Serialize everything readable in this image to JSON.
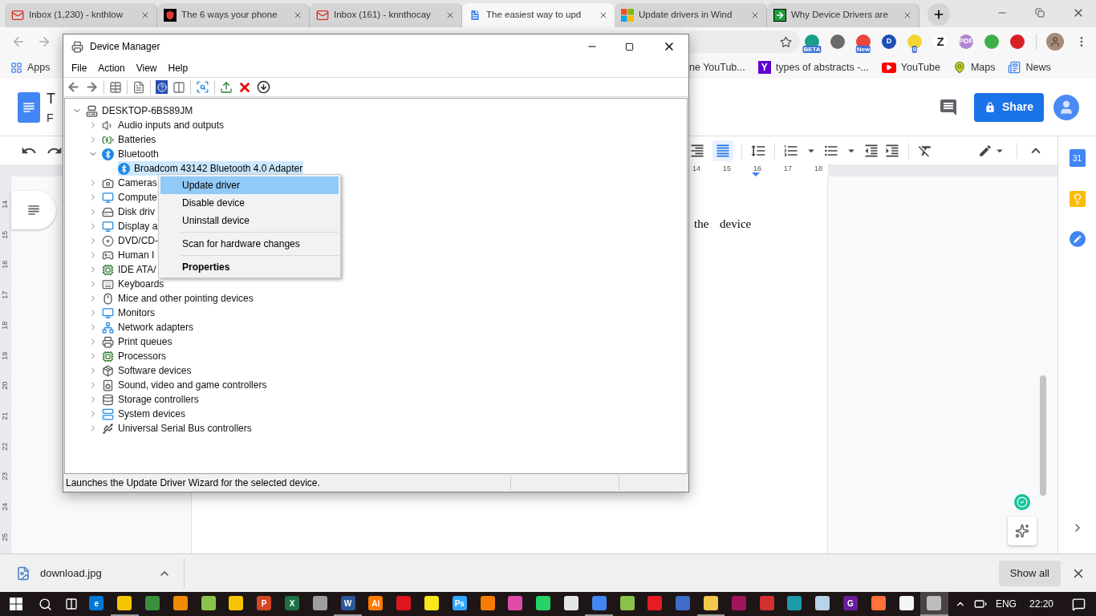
{
  "browser": {
    "tabs": [
      {
        "title": "Inbox (1,230) - knthlow",
        "kind": "gmail",
        "selected": false
      },
      {
        "title": "The 6 ways your phone",
        "kind": "shield",
        "selected": false
      },
      {
        "title": "Inbox (161) - knnthocay",
        "kind": "gmail",
        "selected": false
      },
      {
        "title": "The easiest way to upd",
        "kind": "docs",
        "selected": true
      },
      {
        "title": "Update drivers in Wind",
        "kind": "windows",
        "selected": false
      },
      {
        "title": "Why Device Drivers are",
        "kind": "arrow",
        "selected": false
      }
    ],
    "extensions": [
      {
        "color": "#1a9e8c",
        "badge": "BETA"
      },
      {
        "color": "#6b6b6b"
      },
      {
        "color": "#e8453c",
        "badge": "New"
      },
      {
        "color": "#1e4fb5",
        "glyph": "D"
      },
      {
        "color": "#f5d533",
        "badge": "0"
      },
      {
        "color": "#ffffff",
        "glyph": "Z"
      },
      {
        "color": "#b184d1",
        "glyph": "PDF"
      },
      {
        "color": "#3fae49"
      },
      {
        "color": "#d91f26"
      }
    ],
    "bookmarks": [
      {
        "label": "Apps",
        "kind": "grid"
      },
      {
        "label": "ne YouTub...",
        "kind": "plain"
      },
      {
        "label": "types of abstracts -...",
        "kind": "yahoo",
        "glyph": "Y"
      },
      {
        "label": "YouTube",
        "kind": "youtube"
      },
      {
        "label": "Maps",
        "kind": "maps"
      },
      {
        "label": "News",
        "kind": "news"
      }
    ]
  },
  "docs": {
    "title": "T",
    "subtitle": "F",
    "share": "Share",
    "align": [
      {
        "kind": "right",
        "selected": false
      },
      {
        "kind": "justify",
        "selected": true
      }
    ],
    "ruler": [
      "14",
      "15",
      "16",
      "17",
      "18"
    ],
    "side_ruler": [
      "14",
      "15",
      "16",
      "17",
      "18",
      "19",
      "20",
      "21",
      "22",
      "23",
      "24",
      "25"
    ],
    "body": "the device",
    "calendar": "31"
  },
  "device_manager": {
    "title": "Device Manager",
    "menu": [
      "File",
      "Action",
      "View",
      "Help"
    ],
    "tree": [
      {
        "label": "DESKTOP-6BS89JM",
        "kind": "computer",
        "expanded": true,
        "selected": false,
        "children": [
          {
            "label": "Audio inputs and outputs",
            "kind": "audio",
            "expanded": false,
            "selected": false
          },
          {
            "label": "Batteries",
            "kind": "battery",
            "expanded": false,
            "selected": false
          },
          {
            "label": "Bluetooth",
            "kind": "bluetooth",
            "expanded": true,
            "selected": false,
            "children": [
              {
                "label": "Broadcom 43142 Bluetooth 4.0 Adapter",
                "kind": "bluetooth",
                "selected": true
              }
            ]
          },
          {
            "label": "Cameras",
            "kind": "camera",
            "expanded": false,
            "selected": false
          },
          {
            "label": "Compute",
            "kind": "monitor",
            "expanded": false,
            "selected": false
          },
          {
            "label": "Disk driv",
            "kind": "drive",
            "expanded": false,
            "selected": false
          },
          {
            "label": "Display a",
            "kind": "monitor",
            "expanded": false,
            "selected": false
          },
          {
            "label": "DVD/CD-",
            "kind": "disc",
            "expanded": false,
            "selected": false
          },
          {
            "label": "Human I",
            "kind": "hid",
            "expanded": false,
            "selected": false
          },
          {
            "label": "IDE ATA/",
            "kind": "chip",
            "expanded": false,
            "selected": false
          },
          {
            "label": "Keyboards",
            "kind": "keyboard",
            "expanded": false,
            "selected": false
          },
          {
            "label": "Mice and other pointing devices",
            "kind": "mouse",
            "expanded": false,
            "selected": false
          },
          {
            "label": "Monitors",
            "kind": "monitor",
            "expanded": false,
            "selected": false
          },
          {
            "label": "Network adapters",
            "kind": "network",
            "expanded": false,
            "selected": false
          },
          {
            "label": "Print queues",
            "kind": "printer",
            "expanded": false,
            "selected": false
          },
          {
            "label": "Processors",
            "kind": "chip",
            "expanded": false,
            "selected": false
          },
          {
            "label": "Software devices",
            "kind": "software",
            "expanded": false,
            "selected": false
          },
          {
            "label": "Sound, video and game controllers",
            "kind": "sound",
            "expanded": false,
            "selected": false
          },
          {
            "label": "Storage controllers",
            "kind": "storage",
            "expanded": false,
            "selected": false
          },
          {
            "label": "System devices",
            "kind": "system",
            "expanded": false,
            "selected": false
          },
          {
            "label": "Universal Serial Bus controllers",
            "kind": "usb",
            "expanded": false,
            "selected": false
          }
        ]
      }
    ],
    "status": "Launches the Update Driver Wizard for the selected device."
  },
  "context_menu": {
    "groups": [
      [
        {
          "label": "Update driver",
          "selected": true,
          "default": false
        },
        {
          "label": "Disable device",
          "selected": false,
          "default": false
        },
        {
          "label": "Uninstall device",
          "selected": false,
          "default": false
        }
      ],
      [
        {
          "label": "Scan for hardware changes",
          "selected": false,
          "default": false
        }
      ],
      [
        {
          "label": "Properties",
          "selected": false,
          "default": true
        }
      ]
    ]
  },
  "downloads": {
    "file": "download.jpg",
    "show_all": "Show all"
  },
  "taskbar": {
    "apps": [
      {
        "color": "#0078d7",
        "glyph": "e",
        "running": false,
        "focused": false
      },
      {
        "color": "#f5c400",
        "running": true,
        "focused": false
      },
      {
        "color": "#3a8f3a",
        "running": false,
        "focused": false
      },
      {
        "color": "#f08a00",
        "running": false,
        "focused": false
      },
      {
        "color": "#8bc34a",
        "running": false,
        "focused": false
      },
      {
        "color": "#f5c400",
        "running": false,
        "focused": false
      },
      {
        "color": "#d24726",
        "glyph": "P",
        "running": false,
        "focused": false
      },
      {
        "color": "#1e7145",
        "glyph": "X",
        "running": false,
        "focused": false
      },
      {
        "color": "#9e9e9e",
        "running": false,
        "focused": false
      },
      {
        "color": "#2b579a",
        "glyph": "W",
        "running": true,
        "focused": false
      },
      {
        "color": "#ff7c00",
        "glyph": "Ai",
        "running": false,
        "focused": false
      },
      {
        "color": "#e0141e",
        "running": false,
        "focused": false
      },
      {
        "color": "#f8e71c",
        "running": false,
        "focused": false
      },
      {
        "color": "#31a8ff",
        "glyph": "Ps",
        "running": false,
        "focused": false
      },
      {
        "color": "#f57c00",
        "running": false,
        "focused": false
      },
      {
        "color": "#e04ba8",
        "running": false,
        "focused": false
      },
      {
        "color": "#25d366",
        "running": false,
        "focused": false
      },
      {
        "color": "#e6e6e6",
        "running": false,
        "focused": false
      },
      {
        "color": "#4285f4",
        "running": true,
        "focused": false
      },
      {
        "color": "#8bc34a",
        "running": false,
        "focused": false
      },
      {
        "color": "#e51c23",
        "running": false,
        "focused": false
      },
      {
        "color": "#3f6cc9",
        "running": false,
        "focused": false
      },
      {
        "color": "#f2c94c",
        "running": true,
        "focused": false
      },
      {
        "color": "#a0145a",
        "running": false,
        "focused": false
      },
      {
        "color": "#d32f2f",
        "running": false,
        "focused": false
      },
      {
        "color": "#1b9aaa",
        "running": false,
        "focused": false
      },
      {
        "color": "#b6d3e8",
        "running": false,
        "focused": false
      },
      {
        "color": "#6a1b9a",
        "glyph": "G",
        "running": false,
        "focused": false
      },
      {
        "color": "#ff7139",
        "running": false,
        "focused": false
      },
      {
        "color": "#f5f5f5",
        "running": false,
        "focused": false
      },
      {
        "color": "#bdbdbd",
        "running": true,
        "focused": true
      }
    ],
    "language": "ENG",
    "time": "22:20"
  }
}
